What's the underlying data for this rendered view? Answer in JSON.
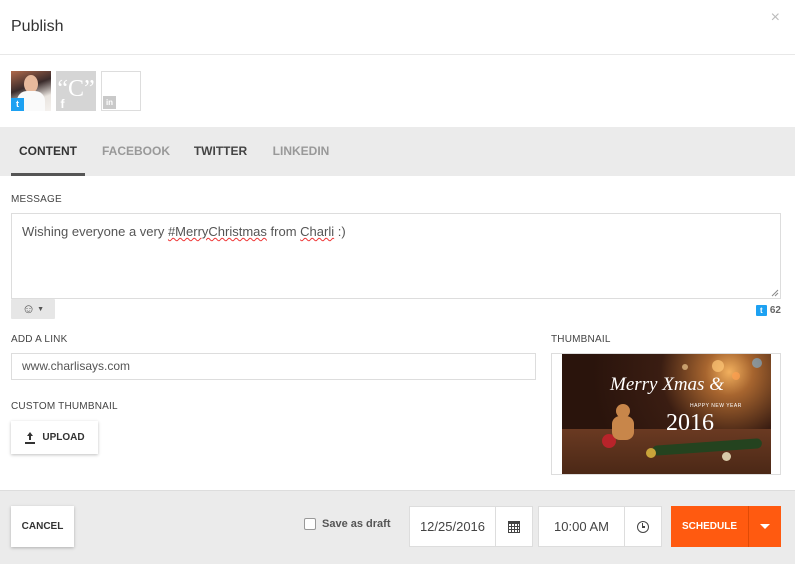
{
  "header": {
    "title": "Publish",
    "close_glyph": "×"
  },
  "accounts": [
    {
      "network": "twitter",
      "badge": "t",
      "icon": "twitter-icon",
      "color": "#1da1f2"
    },
    {
      "network": "facebook",
      "logo_text": "“C”",
      "badge": "f",
      "icon": "facebook-icon"
    },
    {
      "network": "linkedin",
      "badge": "in",
      "icon": "linkedin-icon"
    }
  ],
  "tabs": [
    {
      "label": "CONTENT",
      "active": true
    },
    {
      "label": "FACEBOOK",
      "active": false
    },
    {
      "label": "TWITTER",
      "active": false
    },
    {
      "label": "LINKEDIN",
      "active": false
    }
  ],
  "message": {
    "label": "MESSAGE",
    "text_before": "Wishing everyone a very ",
    "hashtag": "#MerryChristmas",
    "text_mid": " from ",
    "name": "Charli",
    "text_after": " :)",
    "emoji_glyph": "☺",
    "char_count": "62"
  },
  "link": {
    "label": "ADD A LINK",
    "value": "www.charlisays.com"
  },
  "custom_thumbnail": {
    "label": "CUSTOM THUMBNAIL",
    "upload_label": "UPLOAD"
  },
  "thumbnail": {
    "label": "THUMBNAIL",
    "line1": "Merry Xmas &",
    "line2": "HAPPY NEW YEAR",
    "line3": "2016"
  },
  "footer": {
    "cancel_label": "CANCEL",
    "draft_label": "Save as draft",
    "date": "12/25/2016",
    "time": "10:00 AM",
    "schedule_label": "SCHEDULE"
  },
  "colors": {
    "accent": "#ff5a10",
    "twitter": "#1da1f2"
  }
}
